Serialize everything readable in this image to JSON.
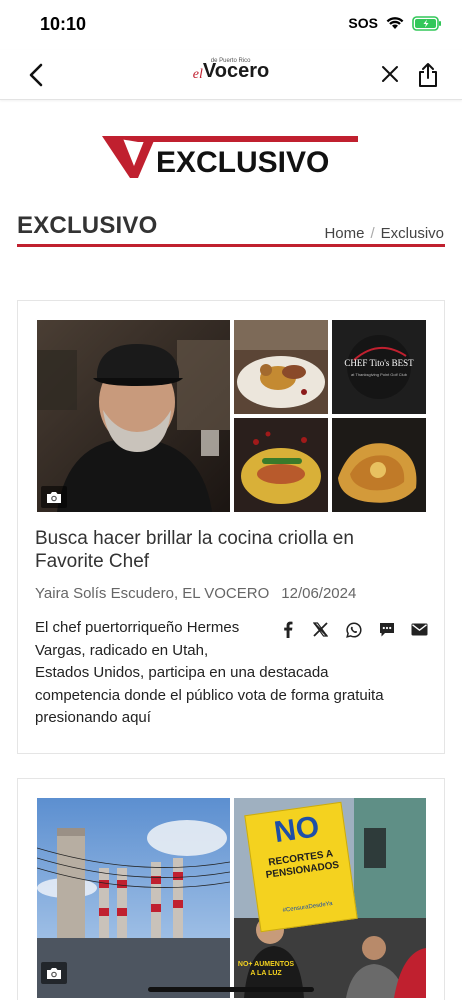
{
  "status_bar": {
    "time": "10:10",
    "sos": "SOS",
    "wifi_icon": "wifi-icon",
    "battery_icon": "battery-charging-icon",
    "battery_color": "#32c759"
  },
  "nav": {
    "back_icon": "chevron-left-icon",
    "logo": {
      "el": "el",
      "vocero": "Vocero",
      "tagline": "de Puerto Rico"
    },
    "close_icon": "close-icon",
    "share_icon": "share-icon"
  },
  "banner": {
    "text": "EXCLUSIVO",
    "letter": "V",
    "accent": "#c0202f"
  },
  "section": {
    "title": "EXCLUSIVO",
    "breadcrumb": {
      "home": "Home",
      "separator": "/",
      "current": "Exclusivo"
    }
  },
  "articles": [
    {
      "headline": "Busca hacer brillar la cocina criolla en Favorite Chef",
      "author": "Yaira Solís Escudero, EL VOCERO",
      "date": "12/06/2024",
      "excerpt": "El chef puertorriqueño Hermes Vargas, radicado en Utah, Estados Unidos, participa en una destacada competencia donde el público vota de forma gratuita presionando aquí",
      "gallery_icon": "camera-icon",
      "images": {
        "logo_text": "CHEF Tito's BEST",
        "logo_sub": "at Thanksgiving Point Golf Club"
      },
      "share": [
        "facebook-icon",
        "x-icon",
        "whatsapp-icon",
        "sms-icon",
        "email-icon"
      ]
    },
    {
      "gallery_icon": "camera-icon",
      "images": {
        "sign_big": "NO",
        "sign_text": "RECORTES A PENSIONADOS",
        "sign_small": "#CensuraDesdeYa",
        "shirt_text": "NO+ AUMENTOS A LA LUZ"
      }
    }
  ]
}
